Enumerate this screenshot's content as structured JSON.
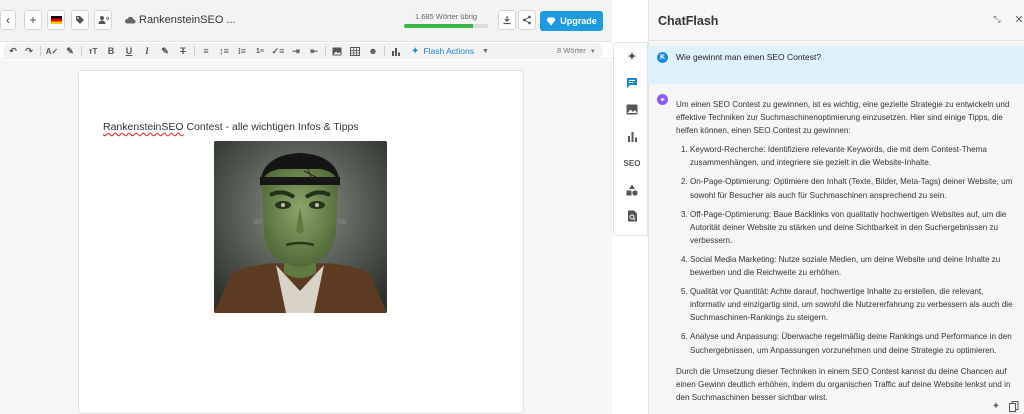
{
  "header": {
    "doc_title": "RankensteinSEO ...",
    "words_left": "1.685 Wörter übrig",
    "words_left_progress": 0.82,
    "upgrade_label": "Upgrade"
  },
  "toolbar": {
    "flash_actions_label": "Flash Actions",
    "word_count": "8 Wörter"
  },
  "document": {
    "heading_brand": "RankensteinSEO",
    "heading_rest": " Contest - alle wichtigen Infos & Tipps"
  },
  "rail": {
    "seo_label": "SEO"
  },
  "chat": {
    "title": "ChatFlash",
    "user_initial": "K",
    "question": "Wie gewinnt man einen SEO Contest?",
    "intro": "Um einen SEO Contest zu gewinnen, ist es wichtig, eine gezielte Strategie zu entwickeln und effektive Techniken zur Suchmaschinenoptimierung einzusetzen. Hier sind einige Tipps, die helfen können, einen SEO Contest zu gewinnen:",
    "tips": [
      "Keyword-Recherche: Identifiziere relevante Keywords, die mit dem Contest-Thema zusammenhängen, und integriere sie gezielt in die Website-Inhalte.",
      "On-Page-Optimierung: Optimiere den Inhalt (Texte, Bilder, Meta-Tags) deiner Website, um sowohl für Besucher als auch für Suchmaschinen ansprechend zu sein.",
      "Off-Page-Optimierung: Baue Backlinks von qualitativ hochwertigen Websites auf, um die Autorität deiner Website zu stärken und deine Sichtbarkeit in den Suchergebnissen zu verbessern.",
      "Social Media Marketing: Nutze soziale Medien, um deine Website und deine Inhalte zu bewerben und die Reichweite zu erhöhen.",
      "Qualität vor Quantität: Achte darauf, hochwertige Inhalte zu erstellen, die relevant, informativ und einzigartig sind, um sowohl die Nutzererfahrung zu verbessern als auch die Suchmaschinen-Rankings zu steigern.",
      "Analyse und Anpassung: Überwache regelmäßig deine Rankings und Performance in den Suchergebnissen, um Anpassungen vorzunehmen und deine Strategie zu optimieren."
    ],
    "outro": "Durch die Umsetzung dieser Techniken in einem SEO Contest kannst du deine Chancen auf einen Gewinn deutlich erhöhen, indem du organischen Traffic auf deine Website lenkst und in den Suchmaschinen besser sichtbar wirst."
  },
  "colors": {
    "accent": "#1e9be0",
    "progress": "#3bb64a",
    "question_bg": "#dff1fb",
    "ai_avatar": "#8b5cf6"
  },
  "icons": [
    "back-icon",
    "plus-icon",
    "german-flag-icon",
    "tag-icon",
    "user-voice-icon",
    "cloud-icon",
    "download-icon",
    "share-icon",
    "diamond-icon",
    "undo-icon",
    "redo-icon",
    "spellcheck-icon",
    "edit-icon",
    "font-size-icon",
    "bold-icon",
    "underline-icon",
    "italic-icon",
    "text-color-icon",
    "clear-format-icon",
    "align-left-icon",
    "line-height-icon",
    "bullet-list-icon",
    "numbered-list-icon",
    "checklist-icon",
    "indent-icon",
    "outdent-icon",
    "image-icon",
    "table-icon",
    "emoji-icon",
    "chart-icon",
    "flash-icon",
    "collapse-icon",
    "close-icon",
    "copy-icon"
  ]
}
